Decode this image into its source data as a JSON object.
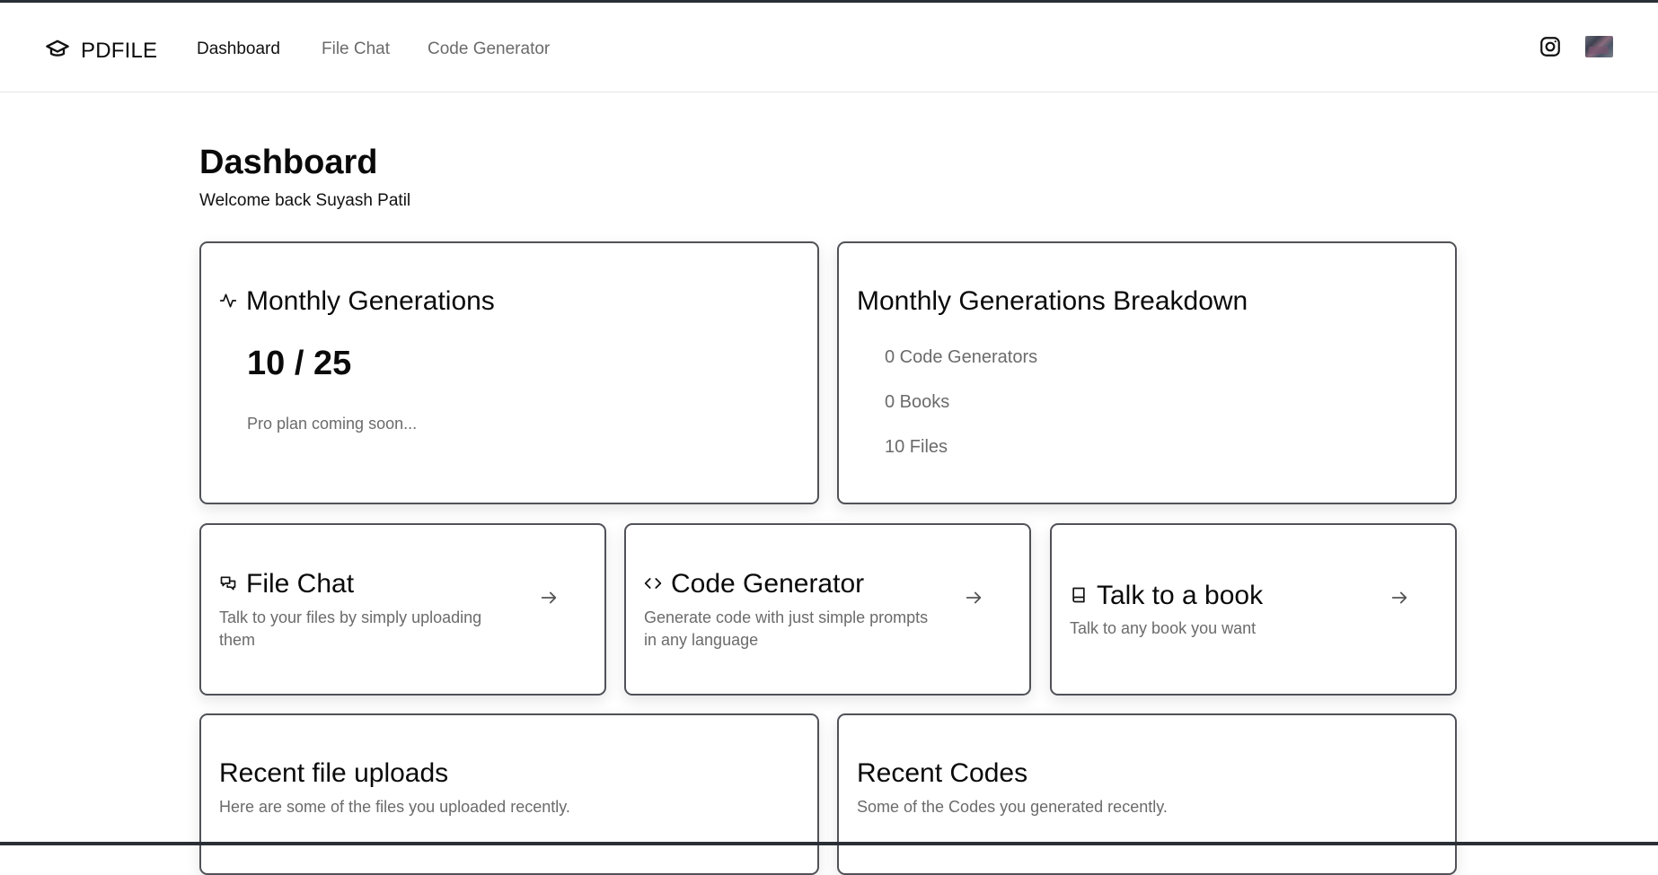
{
  "nav": {
    "brand": "PDFILE",
    "links": [
      "Dashboard",
      "File Chat",
      "Code Generator"
    ],
    "active": "Dashboard",
    "icons": [
      "graduation-cap-icon",
      "instagram-icon"
    ]
  },
  "header": {
    "title": "Dashboard",
    "welcome": "Welcome back Suyash Patil"
  },
  "monthly": {
    "title": "Monthly Generations",
    "stat": "10 / 25",
    "note": "Pro plan coming soon..."
  },
  "breakdown": {
    "title": "Monthly Generations Breakdown",
    "items": [
      "0 Code Generators",
      "0 Books",
      "10 Files"
    ]
  },
  "features": [
    {
      "title": "File Chat",
      "desc_line1": "Talk to your files by simply uploading",
      "desc_line2": "them",
      "icon": "messages-icon"
    },
    {
      "title": "Code Generator",
      "desc_line1": "Generate code with just simple prompts",
      "desc_line2": "in any language",
      "icon": "code-icon"
    },
    {
      "title": "Talk to a book",
      "desc_line1": "Talk to any book you want",
      "desc_line2": "",
      "icon": "book-icon"
    }
  ],
  "recent_uploads": {
    "title": "Recent file uploads",
    "desc": "Here are some of the files you uploaded recently."
  },
  "recent_codes": {
    "title": "Recent Codes",
    "desc": "Some of the Codes you generated recently."
  },
  "colors": {
    "card_border": "#505258",
    "muted_text": "#6b6b6b",
    "frame": "#2a2f36"
  }
}
